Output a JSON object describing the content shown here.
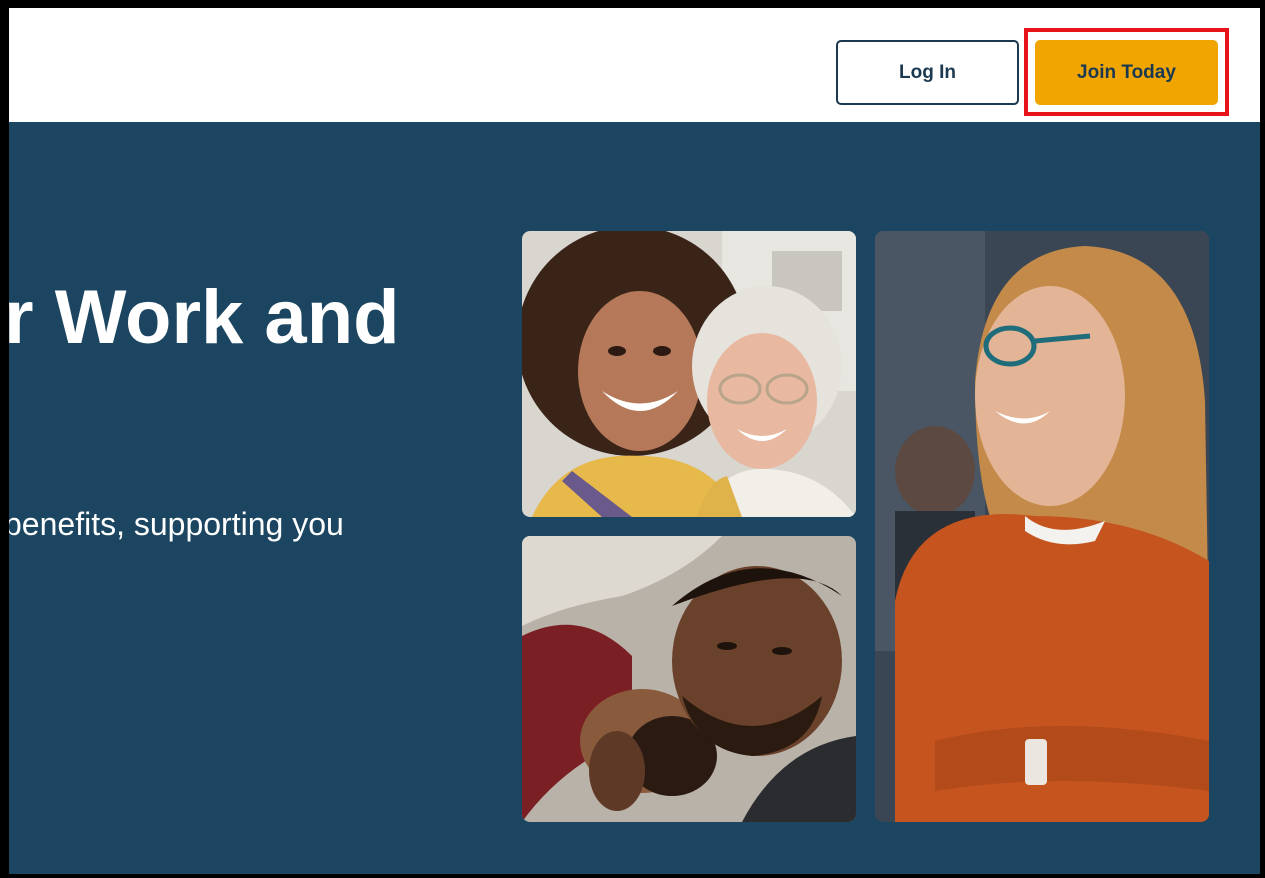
{
  "header": {
    "login_label": "Log In",
    "join_label": "Join Today"
  },
  "hero": {
    "headline": "r Work and",
    "subtext": "benefits, supporting you"
  },
  "images": {
    "photo_a": "photo-two-women-smiling",
    "photo_b": "photo-father-with-baby",
    "photo_c": "photo-woman-orange-sweater-laughing"
  },
  "colors": {
    "hero_bg": "#1b4560",
    "accent": "#f0a500",
    "highlight": "#e6131a",
    "button_text": "#1b3a52"
  }
}
